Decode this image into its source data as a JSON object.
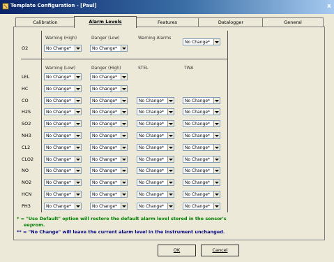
{
  "window": {
    "title": "Template Configuration - [Paul]",
    "close_label": "x"
  },
  "tabs": [
    {
      "label": "Calibration",
      "active": false
    },
    {
      "label": "Alarm Levels",
      "active": true
    },
    {
      "label": "Features",
      "active": false
    },
    {
      "label": "Datalogger",
      "active": false
    },
    {
      "label": "General",
      "active": false
    }
  ],
  "o2_section": {
    "headers": [
      "Warning (High)",
      "Danger (Low)",
      "Warning Alarms"
    ],
    "sensor": "O2",
    "values": [
      "No Change*",
      "No Change*",
      "No Change*"
    ]
  },
  "toxic_section": {
    "headers": [
      "Warning (Low)",
      "Danger (High)",
      "STEL",
      "TWA"
    ],
    "rows": [
      {
        "sensor": "LEL",
        "values": [
          "No Change*",
          "No Change*"
        ]
      },
      {
        "sensor": "HC",
        "values": [
          "No Change*",
          "No Change*"
        ]
      },
      {
        "sensor": "CO",
        "values": [
          "No Change*",
          "No Change*",
          "No Change*",
          "No Change*"
        ]
      },
      {
        "sensor": "H2S",
        "values": [
          "No Change*",
          "No Change*",
          "No Change*",
          "No Change*"
        ]
      },
      {
        "sensor": "SO2",
        "values": [
          "No Change*",
          "No Change*",
          "No Change*",
          "No Change*"
        ]
      },
      {
        "sensor": "NH3",
        "values": [
          "No Change*",
          "No Change*",
          "No Change*",
          "No Change*"
        ]
      },
      {
        "sensor": "CL2",
        "values": [
          "No Change*",
          "No Change*",
          "No Change*",
          "No Change*"
        ]
      },
      {
        "sensor": "CLO2",
        "values": [
          "No Change*",
          "No Change*",
          "No Change*",
          "No Change*"
        ]
      },
      {
        "sensor": "NO",
        "values": [
          "No Change*",
          "No Change*",
          "No Change*",
          "No Change*"
        ]
      },
      {
        "sensor": "NO2",
        "values": [
          "No Change*",
          "No Change*",
          "No Change*",
          "No Change*"
        ]
      },
      {
        "sensor": "HCN",
        "values": [
          "No Change*",
          "No Change*",
          "No Change*",
          "No Change*"
        ]
      },
      {
        "sensor": "PH3",
        "values": [
          "No Change*",
          "No Change*",
          "No Change*",
          "No Change*"
        ]
      }
    ]
  },
  "notes": {
    "note1_line1": "* = \"Use Default\" option will restore the default alarm level stored in the sensor's",
    "note1_line2": "eeprom.",
    "note2": "** = \"No Change\" will leave the current alarm level in the instrument unchanged.",
    "note1_color": "#008000",
    "note2_color": "#000080"
  },
  "buttons": {
    "ok": "OK",
    "cancel": "Cancel"
  }
}
